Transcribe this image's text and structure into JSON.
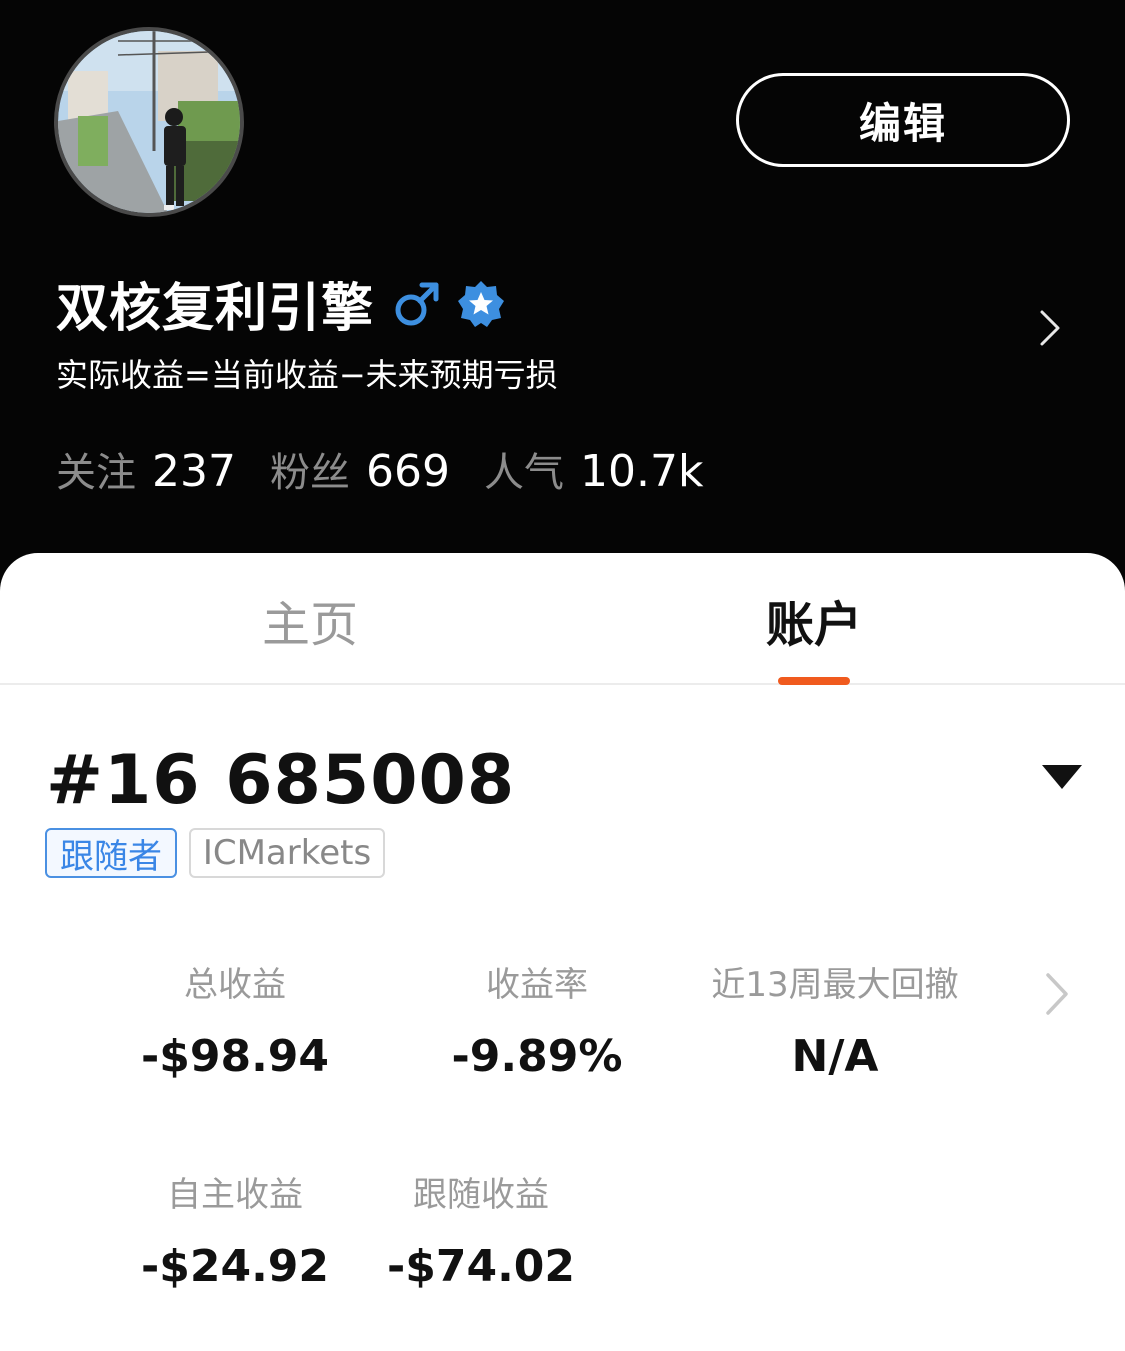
{
  "header": {
    "edit_label": "编辑",
    "username": "双核复利引擎",
    "bio": "实际收益=当前收益−未来预期亏损",
    "stats": [
      {
        "label": "关注",
        "value": "237"
      },
      {
        "label": "粉丝",
        "value": "669"
      },
      {
        "label": "人气",
        "value": "10.7k"
      }
    ],
    "icons": {
      "gender": "male-icon",
      "verified": "verified-badge-icon",
      "chevron": "chevron-right-icon"
    },
    "colors": {
      "gender": "#3d8fe0",
      "verified": "#3d8fe0"
    }
  },
  "tabs": [
    {
      "label": "主页",
      "active": false
    },
    {
      "label": "账户",
      "active": true
    }
  ],
  "account": {
    "id": "#16 685008",
    "tags": [
      "跟随者",
      "ICMarkets"
    ]
  },
  "metrics": {
    "row1": [
      {
        "label": "总收益",
        "value": "-$98.94"
      },
      {
        "label": "收益率",
        "value": "-9.89%"
      },
      {
        "label": "近13周最大回撤",
        "value": "N/A"
      }
    ],
    "row2": [
      {
        "label": "自主收益",
        "value": "-$24.92"
      },
      {
        "label": "跟随收益",
        "value": "-$74.02"
      }
    ]
  },
  "colors": {
    "accent": "#f05a1e",
    "tag_blue": "#3a86e6"
  }
}
